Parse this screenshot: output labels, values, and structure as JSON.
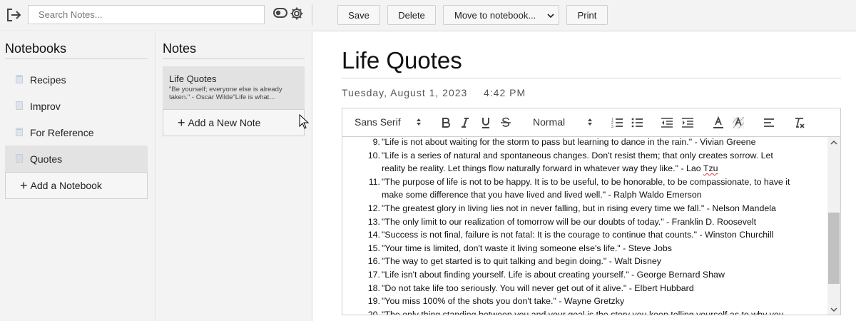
{
  "search": {
    "placeholder": "Search Notes..."
  },
  "toolbar": {
    "save_label": "Save",
    "delete_label": "Delete",
    "move_label": "Move to notebook...",
    "print_label": "Print"
  },
  "notebooks": {
    "title": "Notebooks",
    "items": [
      {
        "label": "Recipes"
      },
      {
        "label": "Improv"
      },
      {
        "label": "For Reference"
      },
      {
        "label": "Quotes"
      }
    ],
    "active_index": 3,
    "add_label": "Add a Notebook"
  },
  "notes": {
    "title": "Notes",
    "items": [
      {
        "title": "Life Quotes",
        "preview": "\"Be yourself; everyone else is already taken.\" - Oscar Wilde\"Life is what..."
      }
    ],
    "add_label": "Add a New Note"
  },
  "editor": {
    "title": "Life Quotes",
    "date": "Tuesday, August 1, 2023",
    "time": "4:42 PM",
    "font_select": "Sans Serif",
    "size_select": "Normal",
    "lines": [
      {
        "num": "9.",
        "text": "\"Life is not about waiting for the storm to pass but learning to dance in the rain.\" - Vivian Greene"
      },
      {
        "num": "10.",
        "text": "\"Life is a series of natural and spontaneous changes. Don't resist them; that only creates sorrow. Let"
      },
      {
        "num": "",
        "text": "reality be reality. Let things flow naturally forward in whatever way they like.\" - Lao ",
        "squiggle": "Tzu"
      },
      {
        "num": "11.",
        "text": "\"The purpose of life is not to be happy. It is to be useful, to be honorable, to be compassionate, to have it"
      },
      {
        "num": "",
        "text": "make some difference that you have lived and lived well.\" - Ralph Waldo Emerson"
      },
      {
        "num": "12.",
        "text": "\"The greatest glory in living lies not in never falling, but in rising every time we fall.\" - Nelson Mandela"
      },
      {
        "num": "13.",
        "text": "\"The only limit to our realization of tomorrow will be our doubts of today.\" - Franklin D. Roosevelt"
      },
      {
        "num": "14.",
        "text": "\"Success is not final, failure is not fatal: It is the courage to continue that counts.\" - Winston Churchill"
      },
      {
        "num": "15.",
        "text": "\"Your time is limited, don't waste it living someone else's life.\" - Steve Jobs"
      },
      {
        "num": "16.",
        "text": "\"The way to get started is to quit talking and begin doing.\" - Walt Disney"
      },
      {
        "num": "17.",
        "text": "\"Life isn't about finding yourself. Life is about creating yourself.\" - George Bernard Shaw"
      },
      {
        "num": "18.",
        "text": "\"Do not take life too seriously. You will never get out of it alive.\" - Elbert Hubbard"
      },
      {
        "num": "19.",
        "text": "\"You miss 100% of the shots you don't take.\" - Wayne Gretzky"
      },
      {
        "num": "20.",
        "text": "\"The only thing standing between you and your goal is the story you keep telling yourself as to why you"
      }
    ]
  },
  "colors": {
    "sidebar_bg": "#f3f3f3",
    "active_bg": "#e3e3e3",
    "spell_error": "#dd3333"
  },
  "icons": [
    "logout-icon",
    "toggle-icon",
    "gear-icon",
    "chevron-down-icon",
    "book-icon",
    "plus-icon",
    "bold-icon",
    "italic-icon",
    "underline-icon",
    "strikethrough-icon",
    "ordered-list-icon",
    "bullet-list-icon",
    "outdent-icon",
    "indent-icon",
    "text-color-icon",
    "highlight-icon",
    "align-icon",
    "clear-format-icon"
  ]
}
